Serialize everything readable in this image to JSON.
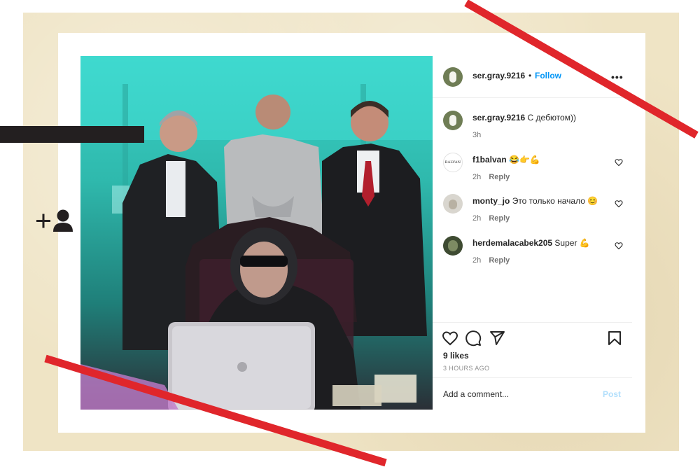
{
  "post": {
    "author": "ser.gray.9216",
    "follow_separator": "•",
    "follow_label": "Follow",
    "more_label": "•••",
    "caption": {
      "username": "ser.gray.9216",
      "text": "С дебютом))",
      "age": "3h"
    },
    "comments": [
      {
        "username": "f1balvan",
        "text": "😂👉💪",
        "age": "2h",
        "reply_label": "Reply",
        "avatar_text": "BALVAN"
      },
      {
        "username": "monty_jo",
        "text": "Это только начало 😊",
        "age": "2h",
        "reply_label": "Reply"
      },
      {
        "username": "herdemalacabek205",
        "text": "Super 💪",
        "age": "2h",
        "reply_label": "Reply"
      }
    ],
    "likes": "9 likes",
    "posted": "3 HOURS AGO",
    "add_comment_placeholder": "Add a comment...",
    "post_label": "Post"
  },
  "icons": [
    "heart-icon",
    "comment-icon",
    "share-icon",
    "bookmark-icon",
    "more-icon",
    "add-user-icon"
  ],
  "colors": {
    "accent": "#0095f6",
    "post_disabled": "#b2dffc",
    "red_stroke": "#e0262b",
    "paper": "#efe4c5",
    "teal_background": "#3ad3c8"
  }
}
